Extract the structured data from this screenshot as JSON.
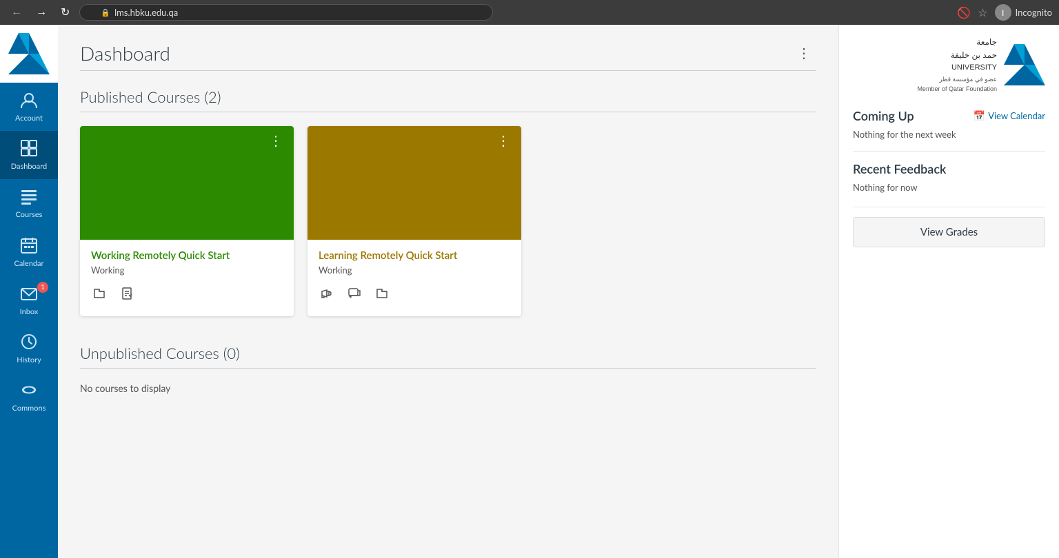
{
  "browser": {
    "url": "lms.hbku.edu.qa",
    "profile_label": "Incognito"
  },
  "sidebar": {
    "items": [
      {
        "id": "account",
        "label": "Account",
        "icon": "👤",
        "active": false
      },
      {
        "id": "dashboard",
        "label": "Dashboard",
        "icon": "🏠",
        "active": true
      },
      {
        "id": "courses",
        "label": "Courses",
        "icon": "📋",
        "active": false
      },
      {
        "id": "calendar",
        "label": "Calendar",
        "icon": "📅",
        "active": false
      },
      {
        "id": "inbox",
        "label": "Inbox",
        "icon": "📬",
        "badge": "1",
        "active": false
      },
      {
        "id": "history",
        "label": "History",
        "icon": "🕐",
        "active": false
      },
      {
        "id": "commons",
        "label": "Commons",
        "icon": "🔄",
        "active": false
      }
    ]
  },
  "page": {
    "title": "Dashboard",
    "published_courses_title": "Published Courses (2)",
    "unpublished_courses_title": "Unpublished Courses (0)",
    "no_courses_message": "No courses to display"
  },
  "courses": [
    {
      "id": "course-1",
      "name": "Working Remotely Quick Start",
      "status": "Working",
      "color_class": "green",
      "name_color": "green-text",
      "icons": [
        "folder",
        "edit"
      ]
    },
    {
      "id": "course-2",
      "name": "Learning Remotely Quick Start",
      "status": "Working",
      "color_class": "olive",
      "name_color": "olive-text",
      "icons": [
        "megaphone",
        "chat",
        "folder"
      ]
    }
  ],
  "right_panel": {
    "university": {
      "name_ar": "جامعة\nحمد بن خليفة\nUNIVERSITY\nعضو في مؤسسة قطر\nMember of Qatar Foundation"
    },
    "coming_up": {
      "title": "Coming Up",
      "view_calendar_label": "View Calendar",
      "nothing_text": "Nothing for the next week"
    },
    "recent_feedback": {
      "title": "Recent Feedback",
      "nothing_text": "Nothing for now"
    },
    "view_grades_label": "View Grades"
  }
}
